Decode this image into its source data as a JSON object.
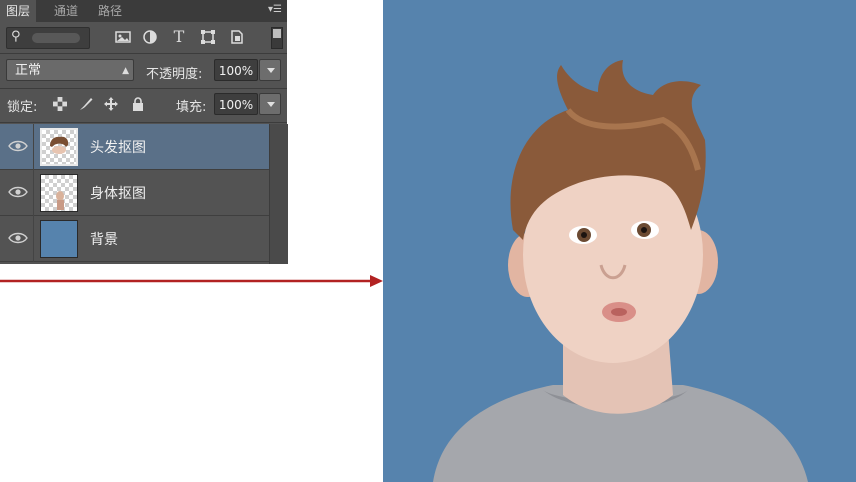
{
  "panel": {
    "tabs": [
      {
        "label": "图层",
        "active": true
      },
      {
        "label": "通道",
        "active": false
      },
      {
        "label": "路径",
        "active": false
      }
    ],
    "menu_icon": "panel-menu-icon",
    "filter": {
      "search_icon": "search-icon",
      "kind_value": "",
      "filter_icons": [
        "pixel-layer-filter-icon",
        "adjustment-layer-filter-icon",
        "type-layer-filter-icon",
        "shape-layer-filter-icon",
        "smart-object-filter-icon"
      ],
      "type_glyph": "T"
    },
    "blend_mode": "正常",
    "opacity_label": "不透明度:",
    "opacity_value": "100%",
    "lock_label": "锁定:",
    "lock_icons": [
      "lock-transparent-pixels-icon",
      "lock-image-pixels-icon",
      "lock-position-icon",
      "lock-all-icon"
    ],
    "fill_label": "填充:",
    "fill_value": "100%",
    "layers": [
      {
        "name": "头发抠图",
        "selected": true,
        "visible": true
      },
      {
        "name": "身体抠图",
        "selected": false,
        "visible": true
      },
      {
        "name": "背景",
        "selected": false,
        "visible": true
      }
    ]
  },
  "colors": {
    "panel_bg": "#535353",
    "selected_layer": "#5a7088",
    "arrow": "#b22222",
    "photo_bg": "#5683ad"
  },
  "photo": {
    "subject": "boy-with-messy-hair-image"
  }
}
